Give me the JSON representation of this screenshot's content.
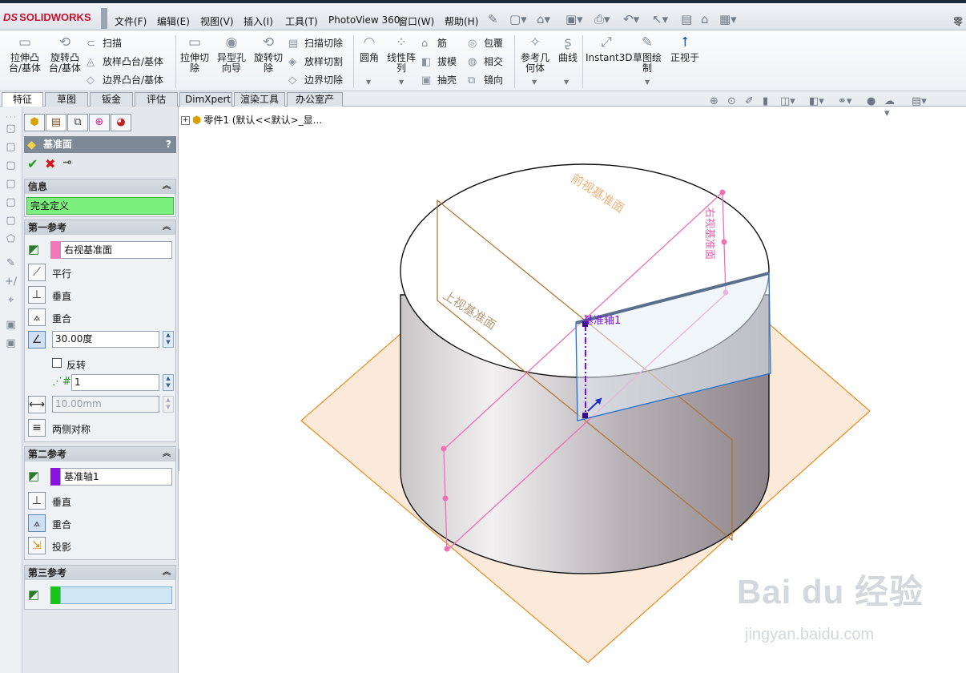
{
  "app": {
    "logo_text": "SOLIDWORKS",
    "logo_mark": "DS",
    "menu": [
      "文件(F)",
      "编辑(E)",
      "视图(V)",
      "插入(I)",
      "工具(T)",
      "PhotoView 360",
      "窗口(W)",
      "帮助(H)"
    ],
    "doc_title_fragment": "零",
    "quick_access_icons": [
      "pin-icon",
      "new-file-icon",
      "open-file-icon",
      "save-icon",
      "print-icon",
      "undo-icon",
      "select-icon",
      "rebuild-icon",
      "options-icon"
    ]
  },
  "ribbon": {
    "big_buttons": [
      {
        "label": "拉伸凸\n台/基体",
        "icon": "extrude-boss-icon"
      },
      {
        "label": "旋转凸\n台/基体",
        "icon": "revolve-boss-icon"
      },
      {
        "label": "拉伸切\n除",
        "icon": "extrude-cut-icon"
      },
      {
        "label": "异型孔\n向导",
        "icon": "hole-wizard-icon"
      },
      {
        "label": "旋转切\n除",
        "icon": "revolve-cut-icon"
      },
      {
        "label": "圆角",
        "icon": "fillet-icon"
      },
      {
        "label": "线性阵\n列",
        "icon": "linear-pattern-icon"
      },
      {
        "label": "参考几\n何体",
        "icon": "reference-geometry-icon"
      },
      {
        "label": "曲线",
        "icon": "curves-icon"
      },
      {
        "label": "Instant3D",
        "icon": "instant3d-icon"
      },
      {
        "label": "草图绘\n制",
        "icon": "sketch-icon"
      },
      {
        "label": "正视于",
        "icon": "normal-to-icon"
      }
    ],
    "small_buttons": [
      {
        "label": "扫描",
        "icon": "sweep-icon"
      },
      {
        "label": "放样凸台/基体",
        "icon": "loft-icon"
      },
      {
        "label": "边界凸台/基体",
        "icon": "boundary-boss-icon"
      },
      {
        "label": "扫描切除",
        "icon": "swept-cut-icon"
      },
      {
        "label": "放样切割",
        "icon": "lofted-cut-icon"
      },
      {
        "label": "边界切除",
        "icon": "boundary-cut-icon"
      },
      {
        "label": "筋",
        "icon": "rib-icon"
      },
      {
        "label": "拔模",
        "icon": "draft-icon"
      },
      {
        "label": "抽壳",
        "icon": "shell-icon"
      },
      {
        "label": "包覆",
        "icon": "wrap-icon"
      },
      {
        "label": "相交",
        "icon": "intersect-icon"
      },
      {
        "label": "镜向",
        "icon": "mirror-icon"
      }
    ]
  },
  "tabs": [
    {
      "label": "特征",
      "active": true
    },
    {
      "label": "草图",
      "active": false
    },
    {
      "label": "钣金",
      "active": false
    },
    {
      "label": "评估",
      "active": false
    },
    {
      "label": "DimXpert",
      "active": false
    },
    {
      "label": "渲染工具",
      "active": false
    },
    {
      "label": "办公室产品",
      "active": false
    }
  ],
  "property_manager": {
    "title": "基准面",
    "help": "?",
    "info": {
      "header": "信息",
      "status": "完全定义"
    },
    "first_ref": {
      "header": "第一参考",
      "selection": "右视基准面",
      "selection_color": "#f07ab8",
      "options": [
        "平行",
        "垂直",
        "重合"
      ],
      "angle": "30.00度",
      "flip_label": "反转",
      "count": "1",
      "distance": "10.00mm",
      "mid_plane": "两侧对称"
    },
    "second_ref": {
      "header": "第二参考",
      "selection": "基准轴1",
      "selection_color": "#8a12e0",
      "options": [
        "垂直",
        "重合",
        "投影"
      ]
    },
    "third_ref": {
      "header": "第三参考",
      "selection": "",
      "selection_color": "#18c418"
    }
  },
  "tree": {
    "expander": "+",
    "root": "零件1  (默认<<默认>_显..."
  },
  "viewport": {
    "labels": {
      "front_plane": "前视基准面",
      "top_plane": "上视基准面",
      "right_plane": "右视基准面",
      "axis": "基准轴1"
    },
    "view_tools": [
      "zoom-to-fit-icon",
      "zoom-area-icon",
      "previous-view-icon",
      "section-view-icon",
      "view-orientation-icon",
      "display-style-icon",
      "hide-show-icon",
      "appearance-icon",
      "scene-icon",
      "view-settings-icon"
    ]
  },
  "watermark": {
    "text": "Bai du 经验",
    "url": "jingyan.baidu.com"
  }
}
